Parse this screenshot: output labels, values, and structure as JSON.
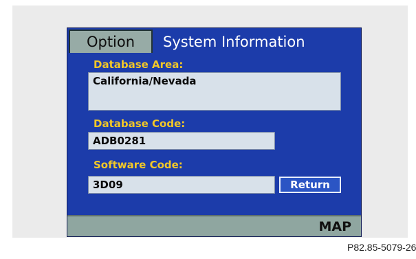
{
  "tabs": {
    "option_label": "Option",
    "title": "System Information"
  },
  "fields": {
    "database_area": {
      "label": "Database Area:",
      "value": "California/Nevada"
    },
    "database_code": {
      "label": "Database Code:",
      "value": "ADB0281"
    },
    "software_code": {
      "label": "Software Code:",
      "value": "3D09"
    }
  },
  "buttons": {
    "return_label": "Return",
    "map_label": "MAP"
  },
  "figure_ref": "P82.85-5079-26",
  "colors": {
    "screen_background": "#1c3caa",
    "label_yellow": "#f3c827",
    "field_background": "#d8e1ea",
    "tab_gray": "#97aba6"
  }
}
